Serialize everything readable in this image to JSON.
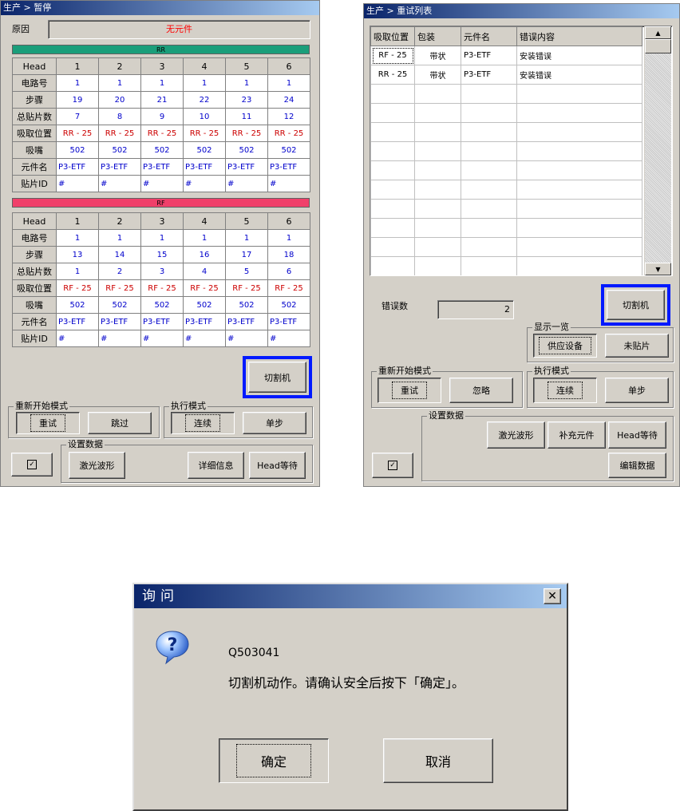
{
  "left_panel": {
    "title": "生产 > 暂停",
    "reason_label": "原因",
    "reason_value": "无元件",
    "rr": {
      "band_label": "RR",
      "band_color": "#1a9e7a",
      "head_label": "Head",
      "heads": [
        "1",
        "2",
        "3",
        "4",
        "5",
        "6"
      ],
      "rows": [
        {
          "label": "电路号",
          "cells": [
            "1",
            "1",
            "1",
            "1",
            "1",
            "1"
          ],
          "cls": "b"
        },
        {
          "label": "步骤",
          "cells": [
            "19",
            "20",
            "21",
            "22",
            "23",
            "24"
          ],
          "cls": "b"
        },
        {
          "label": "总贴片数",
          "cells": [
            "7",
            "8",
            "9",
            "10",
            "11",
            "12"
          ],
          "cls": "b"
        },
        {
          "label": "吸取位置",
          "cells": [
            "RR - 25",
            "RR - 25",
            "RR - 25",
            "RR - 25",
            "RR - 25",
            "RR - 25"
          ],
          "cls": "r"
        },
        {
          "label": "吸嘴",
          "cells": [
            "502",
            "502",
            "502",
            "502",
            "502",
            "502"
          ],
          "cls": "b"
        },
        {
          "label": "元件名",
          "cells": [
            "P3-ETF",
            "P3-ETF",
            "P3-ETF",
            "P3-ETF",
            "P3-ETF",
            "P3-ETF"
          ],
          "cls": "b l"
        },
        {
          "label": "贴片ID",
          "cells": [
            "#",
            "#",
            "#",
            "#",
            "#",
            "#"
          ],
          "cls": "b l"
        }
      ]
    },
    "rf": {
      "band_label": "RF",
      "band_color": "#f0406a",
      "head_label": "Head",
      "heads": [
        "1",
        "2",
        "3",
        "4",
        "5",
        "6"
      ],
      "rows": [
        {
          "label": "电路号",
          "cells": [
            "1",
            "1",
            "1",
            "1",
            "1",
            "1"
          ],
          "cls": "b"
        },
        {
          "label": "步骤",
          "cells": [
            "13",
            "14",
            "15",
            "16",
            "17",
            "18"
          ],
          "cls": "b"
        },
        {
          "label": "总贴片数",
          "cells": [
            "1",
            "2",
            "3",
            "4",
            "5",
            "6"
          ],
          "cls": "b"
        },
        {
          "label": "吸取位置",
          "cells": [
            "RF - 25",
            "RF - 25",
            "RF - 25",
            "RF - 25",
            "RF - 25",
            "RF - 25"
          ],
          "cls": "r"
        },
        {
          "label": "吸嘴",
          "cells": [
            "502",
            "502",
            "502",
            "502",
            "502",
            "502"
          ],
          "cls": "b"
        },
        {
          "label": "元件名",
          "cells": [
            "P3-ETF",
            "P3-ETF",
            "P3-ETF",
            "P3-ETF",
            "P3-ETF",
            "P3-ETF"
          ],
          "cls": "b l"
        },
        {
          "label": "贴片ID",
          "cells": [
            "#",
            "#",
            "#",
            "#",
            "#",
            "#"
          ],
          "cls": "b l"
        }
      ]
    },
    "cutter_button": "切割机",
    "restart_mode_label": "重新开始模式",
    "retry_button": "重试",
    "skip_button": "跳过",
    "exec_mode_label": "执行模式",
    "continuous_button": "连续",
    "single_step_button": "单步",
    "settings_label": "设置数据",
    "laser_button": "激光波形",
    "details_button": "详细信息",
    "head_wait_button": "Head等待",
    "check_icon": "checkmark-icon"
  },
  "right_panel": {
    "title": "生产 > 重试列表",
    "columns": [
      "吸取位置",
      "包装",
      "元件名",
      "错误内容"
    ],
    "rows": [
      [
        "RF - 25",
        "带状",
        "P3-ETF",
        "安装错误"
      ],
      [
        "RR - 25",
        "带状",
        "P3-ETF",
        "安装错误"
      ]
    ],
    "error_count_label": "错误数",
    "error_count_value": "2",
    "cutter_button": "切割机",
    "display_list_label": "显示一览",
    "supply_button": "供应设备",
    "not_mounted_button": "未贴片",
    "restart_mode_label": "重新开始模式",
    "retry_button": "重试",
    "ignore_button": "忽略",
    "exec_mode_label": "执行模式",
    "continuous_button": "连续",
    "single_step_button": "单步",
    "settings_label": "设置数据",
    "laser_button": "激光波形",
    "replenish_button": "补充元件",
    "head_wait_button": "Head等待",
    "edit_data_button": "编辑数据"
  },
  "dialog": {
    "title": "询问",
    "code": "Q503041",
    "message": "切割机动作。请确认安全后按下「确定」。",
    "ok_button": "确定",
    "cancel_button": "取消",
    "icon": "question-icon"
  },
  "colors": {
    "highlight": "#0019ff",
    "title_start": "#0a246a",
    "title_end": "#a6caf0",
    "reason_red": "#ff0000"
  }
}
